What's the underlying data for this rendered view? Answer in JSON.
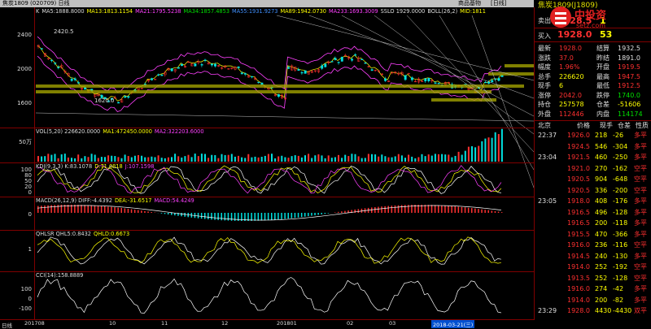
{
  "window": {
    "title": "焦炭1809 (020709) 日线",
    "menu_right": [
      "商品基物",
      "[日线]"
    ]
  },
  "colors": {
    "red": "#ff3030",
    "green": "#00e000",
    "yellow": "#ffff00",
    "cyan": "#00e0e0",
    "grid": "#800000",
    "magenta": "#ff40ff"
  },
  "main_pane": {
    "header": [
      {
        "text": "K",
        "color": "#ddd"
      },
      {
        "text": "MA5:1888.8000",
        "color": "#ddd"
      },
      {
        "text": "MA13:1813.1154",
        "color": "#ffff00"
      },
      {
        "text": "MA21:1795.5238",
        "color": "#ff40ff"
      },
      {
        "text": "MA34:1857.4853",
        "color": "#00e000"
      },
      {
        "text": "MA55:1931.9273",
        "color": "#4090ff"
      },
      {
        "text": "MA89:1942.0730",
        "color": "#ffff00"
      },
      {
        "text": "MA233:1693.3009",
        "color": "#ff40ff"
      },
      {
        "text": "SSLO 1929.0000",
        "color": "#ddd"
      },
      {
        "text": "BOLL(26,2)",
        "color": "#ddd"
      },
      {
        "text": "MID:1811",
        "color": "#ffff00"
      }
    ],
    "yticks": [
      "2400",
      "2000",
      "1600"
    ],
    "annotations": [
      "2420.5",
      "1620.0"
    ]
  },
  "vol_pane": {
    "header": [
      {
        "text": "VOL(5,20) 226620.0000",
        "color": "#ddd"
      },
      {
        "text": "MA1:472450.0000",
        "color": "#ffff00"
      },
      {
        "text": "MA2:322203.6000",
        "color": "#ff40ff"
      }
    ],
    "yticks": [
      "50万"
    ]
  },
  "kdj_pane": {
    "header": [
      {
        "text": "KDJ(9,3,3) K:83.1078",
        "color": "#ddd"
      },
      {
        "text": "D:71.0818",
        "color": "#ffff00"
      },
      {
        "text": "J:107.1598",
        "color": "#ff40ff"
      }
    ],
    "yticks": [
      "100",
      "80",
      "50",
      "20",
      "0"
    ]
  },
  "macd_pane": {
    "header": [
      {
        "text": "MACD(26,12,9) DIFF:-4.4392",
        "color": "#ddd"
      },
      {
        "text": "DEA:-31.6517",
        "color": "#ffff00"
      },
      {
        "text": "MACD:54.4249",
        "color": "#ff40ff"
      }
    ],
    "yticks": [
      "0"
    ]
  },
  "qhlsr_pane": {
    "header": [
      {
        "text": "QHLSR QHL5:0.8432",
        "color": "#ddd"
      },
      {
        "text": "QHLD:0.6673",
        "color": "#ffff00"
      }
    ],
    "yticks": [
      "1"
    ]
  },
  "cci_pane": {
    "header": [
      {
        "text": "CCI(14):158.8889",
        "color": "#ddd"
      }
    ],
    "yticks": [
      "100",
      "0",
      "-100"
    ]
  },
  "xaxis": {
    "tab": "日线",
    "labels": [
      "201708",
      "10",
      "11",
      "12",
      "201801",
      "02",
      "03"
    ],
    "selected": "2018-03-21(三)"
  },
  "right_panel": {
    "title": "焦炭1809(J1809)",
    "sell": {
      "label": "卖出",
      "price": "1928.5",
      "qty": "1"
    },
    "buy": {
      "label": "买入",
      "price": "1928.0",
      "qty": "53"
    },
    "stats": [
      {
        "l": "最新",
        "v": "1928.0",
        "vc": "red",
        "l2": "结算",
        "v2": "1932.5",
        "v2c": "wht"
      },
      {
        "l": "涨跌",
        "v": "37.0",
        "vc": "red",
        "l2": "昨结",
        "v2": "1891.0",
        "v2c": "wht"
      },
      {
        "l": "幅度",
        "v": "1.96%",
        "vc": "red",
        "l2": "开盘",
        "v2": "1919.5",
        "v2c": "red"
      },
      {
        "l": "总手",
        "v": "226620",
        "vc": "yel",
        "l2": "最高",
        "v2": "1947.5",
        "v2c": "red"
      },
      {
        "l": "现手",
        "v": "6",
        "vc": "yel",
        "l2": "最低",
        "v2": "1912.5",
        "v2c": "red"
      },
      {
        "l": "涨停",
        "v": "2042.0",
        "vc": "red",
        "l2": "跌停",
        "v2": "1740.0",
        "v2c": "grn"
      },
      {
        "l": "持仓",
        "v": "257578",
        "vc": "yel",
        "l2": "仓差",
        "v2": "-51606",
        "v2c": "yel"
      },
      {
        "l": "外盘",
        "v": "112446",
        "vc": "red",
        "l2": "内盘",
        "v2": "114174",
        "v2c": "grn"
      }
    ],
    "tick_header": [
      "北京",
      "价格",
      "现手",
      "仓差",
      "性质"
    ],
    "ticks": [
      {
        "t": "22:37",
        "p": "1926.0",
        "pc": "red",
        "q": "218",
        "d": "-26",
        "n": "多平",
        "nc": "red"
      },
      {
        "t": "",
        "p": "1924.5",
        "pc": "red",
        "q": "546",
        "d": "-304",
        "n": "多平",
        "nc": "red"
      },
      {
        "t": "23:04",
        "p": "1921.5",
        "pc": "red",
        "q": "460",
        "d": "-250",
        "n": "多平",
        "nc": "red"
      },
      {
        "t": "",
        "p": "1921.0",
        "pc": "red",
        "q": "270",
        "d": "-162",
        "n": "空平",
        "nc": "red"
      },
      {
        "t": "",
        "p": "1920.5",
        "pc": "red",
        "q": "904",
        "d": "-648",
        "n": "空平",
        "nc": "red"
      },
      {
        "t": "",
        "p": "1920.5",
        "pc": "red",
        "q": "336",
        "d": "-200",
        "n": "空平",
        "nc": "red"
      },
      {
        "t": "23:05",
        "p": "1918.0",
        "pc": "red",
        "q": "408",
        "d": "-176",
        "n": "多平",
        "nc": "red"
      },
      {
        "t": "",
        "p": "1916.5",
        "pc": "red",
        "q": "496",
        "d": "-128",
        "n": "多平",
        "nc": "red"
      },
      {
        "t": "",
        "p": "1916.5",
        "pc": "red",
        "q": "200",
        "d": "-118",
        "n": "多平",
        "nc": "red"
      },
      {
        "t": "",
        "p": "1915.5",
        "pc": "red",
        "q": "470",
        "d": "-366",
        "n": "多平",
        "nc": "red"
      },
      {
        "t": "",
        "p": "1916.0",
        "pc": "red",
        "q": "236",
        "d": "-116",
        "n": "空平",
        "nc": "red"
      },
      {
        "t": "",
        "p": "1914.5",
        "pc": "red",
        "q": "240",
        "d": "-130",
        "n": "多平",
        "nc": "red"
      },
      {
        "t": "",
        "p": "1914.0",
        "pc": "red",
        "q": "252",
        "n": "空平",
        "d": "-192",
        "nc": "red"
      },
      {
        "t": "",
        "p": "1913.5",
        "pc": "red",
        "q": "252",
        "d": "-128",
        "n": "空平",
        "nc": "red"
      },
      {
        "t": "",
        "p": "1916.0",
        "pc": "red",
        "q": "274",
        "d": "-42",
        "n": "多平",
        "nc": "red"
      },
      {
        "t": "",
        "p": "1914.0",
        "pc": "red",
        "q": "200",
        "d": "-82",
        "n": "多平",
        "nc": "red"
      },
      {
        "t": "23:29",
        "p": "1928.0",
        "pc": "red",
        "q": "4430",
        "d": "-4430",
        "n": "双平",
        "nc": "red"
      }
    ],
    "logo": {
      "text": "中投资",
      "sub": "setz.com"
    }
  }
}
